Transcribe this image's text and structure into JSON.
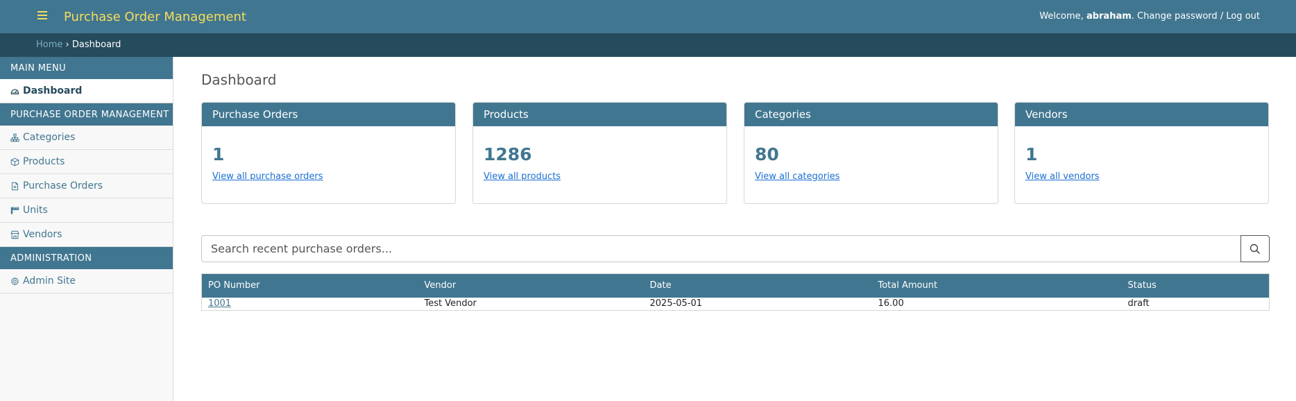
{
  "header": {
    "title": "Purchase Order Management",
    "welcome": "Welcome,",
    "username": "abraham",
    "change_password": "Change password",
    "separator": "/",
    "logout": "Log out",
    "title_color": "#f5dd5d",
    "bg_color": "#417690"
  },
  "breadcrumbs": {
    "home": "Home",
    "separator": "›",
    "current": "Dashboard"
  },
  "sidebar": {
    "main_menu": {
      "heading": "MAIN MENU",
      "items": [
        {
          "label": "Dashboard",
          "icon": "dashboard-icon",
          "active": true
        }
      ]
    },
    "po_management": {
      "heading": "PURCHASE ORDER MANAGEMENT",
      "items": [
        {
          "label": "Categories",
          "icon": "sitemap-icon"
        },
        {
          "label": "Products",
          "icon": "box-icon"
        },
        {
          "label": "Purchase Orders",
          "icon": "document-icon"
        },
        {
          "label": "Units",
          "icon": "ruler-icon"
        },
        {
          "label": "Vendors",
          "icon": "store-icon"
        }
      ]
    },
    "administration": {
      "heading": "ADMINISTRATION",
      "items": [
        {
          "label": "Admin Site",
          "icon": "gear-icon"
        }
      ]
    }
  },
  "main": {
    "title": "Dashboard",
    "cards": [
      {
        "title": "Purchase Orders",
        "count": "1",
        "link": "View all purchase orders"
      },
      {
        "title": "Products",
        "count": "1286",
        "link": "View all products"
      },
      {
        "title": "Categories",
        "count": "80",
        "link": "View all categories"
      },
      {
        "title": "Vendors",
        "count": "1",
        "link": "View all vendors"
      }
    ],
    "search": {
      "placeholder": "Search recent purchase orders...",
      "value": "",
      "button_icon": "search-icon"
    },
    "table": {
      "columns": [
        "PO Number",
        "Vendor",
        "Date",
        "Total Amount",
        "Status"
      ],
      "rows": [
        [
          "1001",
          "Test Vendor",
          "2025-05-01",
          "16.00",
          "draft"
        ]
      ]
    }
  }
}
